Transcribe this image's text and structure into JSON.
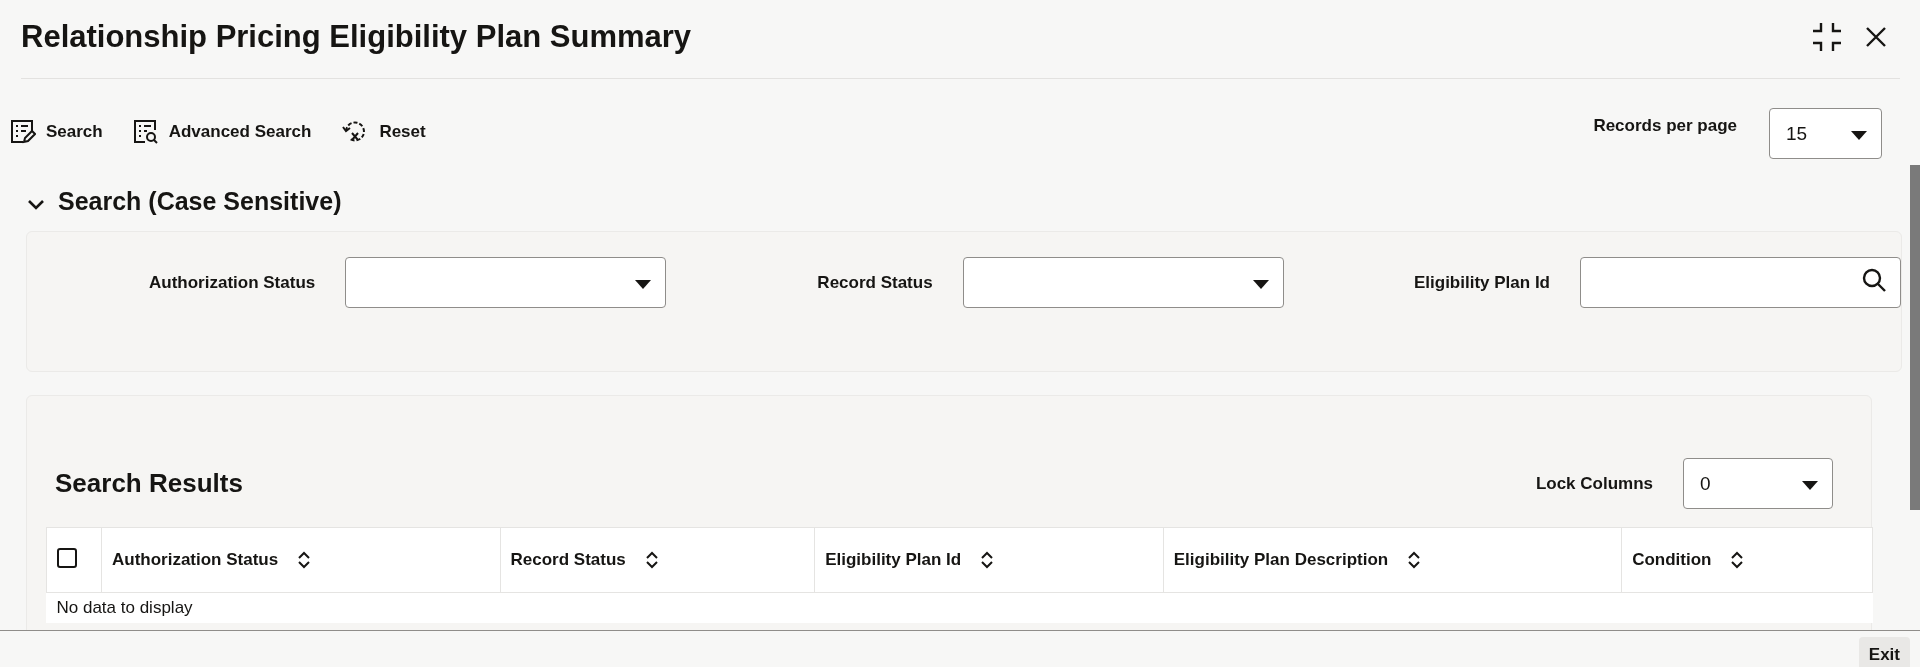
{
  "window": {
    "title": "Relationship Pricing Eligibility Plan Summary"
  },
  "toolbar": {
    "buttons": [
      {
        "label": "Search",
        "kind": "search"
      },
      {
        "label": "Advanced Search",
        "kind": "advanced"
      },
      {
        "label": "Reset",
        "kind": "reset"
      }
    ],
    "records_per_page": {
      "label": "Records per page",
      "value": "15"
    }
  },
  "search_section": {
    "title": "Search (Case Sensitive)",
    "expanded": true,
    "fields": [
      {
        "label": "Authorization Status",
        "kind": "select"
      },
      {
        "label": "Record Status",
        "kind": "select"
      },
      {
        "label": "Eligibility Plan Id",
        "kind": "lookup"
      }
    ]
  },
  "results": {
    "title": "Search Results",
    "lock_columns": {
      "label": "Lock Columns",
      "value": "0"
    },
    "select_all": {
      "checked": false
    },
    "columns": [
      "Authorization Status",
      "Record Status",
      "Eligibility Plan Id",
      "Eligibility Plan Description",
      "Condition"
    ],
    "empty_message": "No data to display"
  },
  "footer": {
    "buttons": [
      "Exit"
    ]
  }
}
